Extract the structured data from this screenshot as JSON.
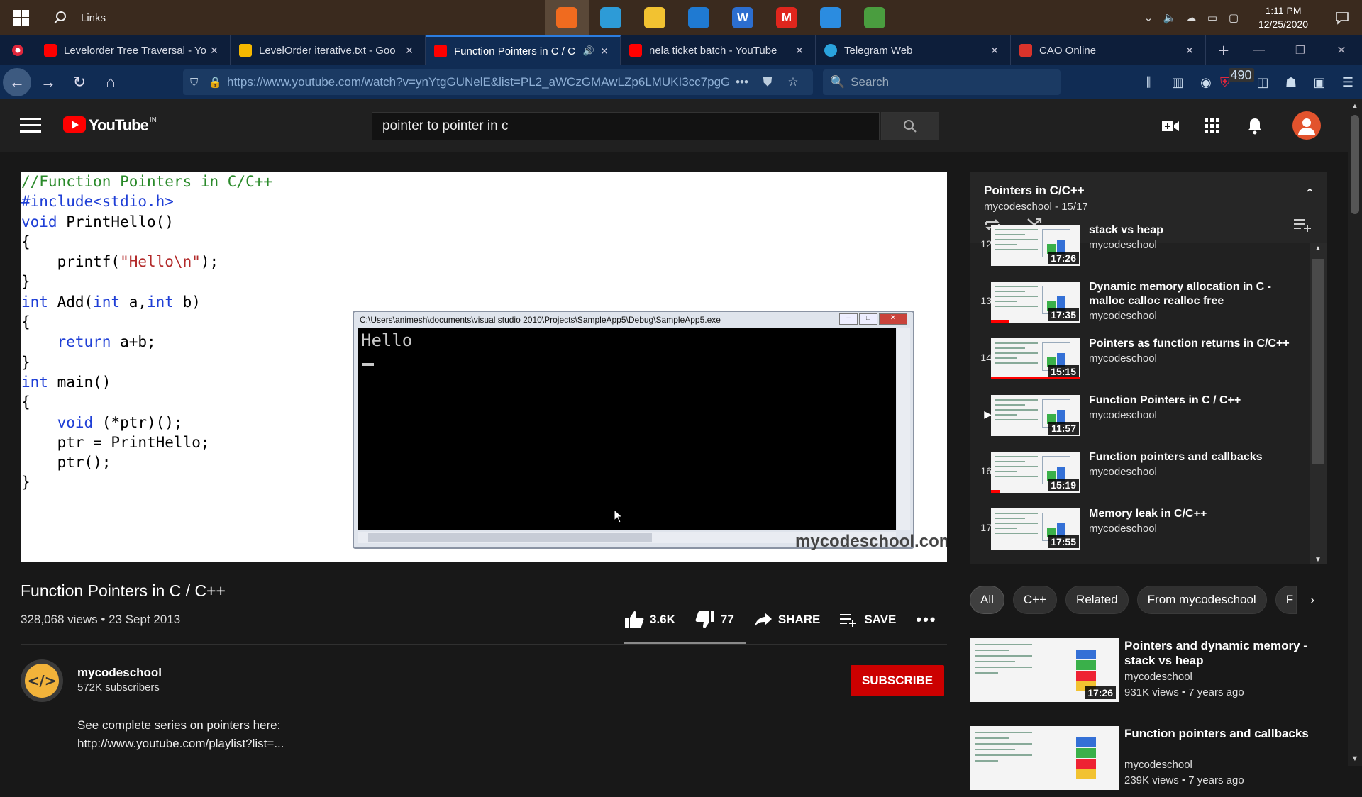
{
  "taskbar": {
    "links_label": "Links",
    "apps": [
      {
        "name": "firefox-app",
        "glyph": "",
        "color": "#f06b1f",
        "active": true
      },
      {
        "name": "edge-app",
        "glyph": "",
        "color": "#2d9bd7",
        "active": false
      },
      {
        "name": "file-explorer-app",
        "glyph": "",
        "color": "#f2c231",
        "active": false
      },
      {
        "name": "mail-app",
        "glyph": "",
        "color": "#1f7ad2",
        "active": false
      },
      {
        "name": "wps-writer-app",
        "glyph": "W",
        "color": "#2c6ecf",
        "active": false
      },
      {
        "name": "m-app",
        "glyph": "M",
        "color": "#e0261d",
        "active": false
      },
      {
        "name": "vscode-app",
        "glyph": "",
        "color": "#2b8ce0",
        "active": false
      },
      {
        "name": "sheet-app",
        "glyph": "",
        "color": "#4a9d3f",
        "active": false
      }
    ],
    "clock_time": "1:11 PM",
    "clock_date": "12/25/2020"
  },
  "tabs": [
    {
      "label": "Levelorder Tree Traversal - Yo",
      "favicon": "youtube",
      "active": false
    },
    {
      "label": "LevelOrder iterative.txt - Goo",
      "favicon": "drive",
      "active": false
    },
    {
      "label": "Function Pointers in C / C",
      "favicon": "youtube",
      "active": true
    },
    {
      "label": "nela ticket batch - YouTube",
      "favicon": "youtube",
      "active": false
    },
    {
      "label": "Telegram Web",
      "favicon": "telegram",
      "active": false
    },
    {
      "label": "CAO Online",
      "favicon": "cao",
      "active": false
    }
  ],
  "navbar": {
    "url": "https://www.youtube.com/watch?v=ynYtgGUNelE&list=PL2_aWCzGMAwLZp6LMUKI3cc7pgG",
    "search_placeholder": "Search",
    "badge_count": "490"
  },
  "youtube": {
    "logo_text": "YouTube",
    "region": "IN",
    "search_value": "pointer to pointer in c"
  },
  "video": {
    "code_lines": [
      [
        [
          "//Function Pointers in C/C++",
          "cm"
        ]
      ],
      [
        [
          "#include<stdio.h>",
          "pp"
        ]
      ],
      [
        [
          "void",
          "kw"
        ],
        [
          " PrintHello()",
          ""
        ]
      ],
      [
        [
          "{",
          ""
        ]
      ],
      [
        [
          "    printf(",
          ""
        ],
        [
          "\"Hello\\n\"",
          "st"
        ],
        [
          ");",
          ""
        ]
      ],
      [
        [
          "}",
          ""
        ]
      ],
      [
        [
          "int",
          "kw"
        ],
        [
          " Add(",
          ""
        ],
        [
          "int",
          "kw"
        ],
        [
          " a,",
          ""
        ],
        [
          "int",
          "kw"
        ],
        [
          " b)",
          ""
        ]
      ],
      [
        [
          "{",
          ""
        ]
      ],
      [
        [
          "    ",
          ""
        ],
        [
          "return",
          "kw"
        ],
        [
          " a+b;",
          ""
        ]
      ],
      [
        [
          "}",
          ""
        ]
      ],
      [
        [
          "int",
          "kw"
        ],
        [
          " main()",
          ""
        ]
      ],
      [
        [
          "{",
          ""
        ]
      ],
      [
        [
          "    ",
          ""
        ],
        [
          "void",
          "kw"
        ],
        [
          " (*ptr)();",
          ""
        ]
      ],
      [
        [
          "    ptr = PrintHello;",
          ""
        ]
      ],
      [
        [
          "    ptr();",
          ""
        ]
      ],
      [
        [
          "}",
          ""
        ]
      ]
    ],
    "console_title": "C:\\Users\\animesh\\documents\\visual studio 2010\\Projects\\SampleApp5\\Debug\\SampleApp5.exe",
    "console_output": "Hello",
    "watermark": "mycodeschool.com",
    "title": "Function Pointers in C / C++",
    "meta": "328,068 views • 23 Sept 2013",
    "likes": "3.6K",
    "dislikes": "77",
    "share_label": "SHARE",
    "save_label": "SAVE"
  },
  "channel": {
    "name": "mycodeschool",
    "subscribers": "572K subscribers",
    "subscribe_label": "SUBSCRIBE",
    "description_line1": "See complete series on pointers here:",
    "description_line2": "http://www.youtube.com/playlist?list=..."
  },
  "playlist": {
    "title": "Pointers in C/C++",
    "subtitle": "mycodeschool - 15/17",
    "items": [
      {
        "index": "12",
        "title": "stack vs heap",
        "channel": "mycodeschool",
        "duration": "17:26",
        "progress": 0,
        "playing": false
      },
      {
        "index": "13",
        "title": "Dynamic memory allocation in C - malloc calloc realloc free",
        "channel": "mycodeschool",
        "duration": "17:35",
        "progress": 0.2,
        "playing": false
      },
      {
        "index": "14",
        "title": "Pointers as function returns in C/C++",
        "channel": "mycodeschool",
        "duration": "15:15",
        "progress": 1.0,
        "playing": false
      },
      {
        "index": "",
        "title": "Function Pointers in C / C++",
        "channel": "mycodeschool",
        "duration": "11:57",
        "progress": 0,
        "playing": true
      },
      {
        "index": "16",
        "title": "Function pointers and callbacks",
        "channel": "mycodeschool",
        "duration": "15:19",
        "progress": 0.1,
        "playing": false
      },
      {
        "index": "17",
        "title": "Memory leak in C/C++",
        "channel": "mycodeschool",
        "duration": "17:55",
        "progress": 0,
        "playing": false
      }
    ]
  },
  "chips": [
    "All",
    "C++",
    "Related",
    "From mycodeschool",
    "F"
  ],
  "related": [
    {
      "title": "Pointers and dynamic memory - stack vs heap",
      "channel": "mycodeschool",
      "meta": "931K views • 7 years ago",
      "duration": "17:26"
    },
    {
      "title": "Function pointers and callbacks",
      "channel": "mycodeschool",
      "meta": "239K views • 7 years ago",
      "duration": ""
    }
  ]
}
